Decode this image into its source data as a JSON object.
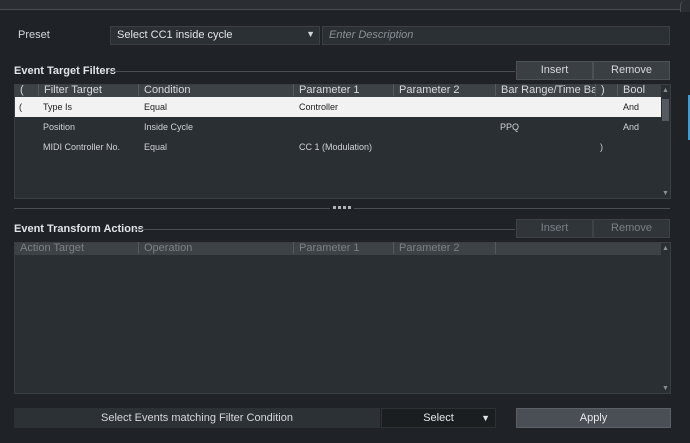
{
  "preset": {
    "label": "Preset",
    "value": "Select CC1 inside cycle",
    "description_placeholder": "Enter Description"
  },
  "filters": {
    "title": "Event Target Filters",
    "insert_label": "Insert",
    "remove_label": "Remove",
    "columns": [
      "(",
      "Filter Target",
      "Condition",
      "Parameter 1",
      "Parameter 2",
      "Bar Range/Time Base",
      ")",
      "Bool"
    ],
    "rows": [
      {
        "open": "(",
        "target": "Type Is",
        "condition": "Equal",
        "param1": "Controller",
        "param2": "",
        "range": "",
        "close": "",
        "bool": "And"
      },
      {
        "open": "",
        "target": "Position",
        "condition": "Inside Cycle",
        "param1": "",
        "param2": "",
        "range": "PPQ",
        "close": "",
        "bool": "And"
      },
      {
        "open": "",
        "target": "MIDI Controller No.",
        "condition": "Equal",
        "param1": "CC 1  (Modulation)",
        "param2": "",
        "range": "",
        "close": ")",
        "bool": ""
      }
    ]
  },
  "actions": {
    "title": "Event Transform Actions",
    "insert_label": "Insert",
    "remove_label": "Remove",
    "columns": [
      "Action Target",
      "Operation",
      "Parameter 1",
      "Parameter 2"
    ]
  },
  "footer": {
    "match_label": "Select Events matching Filter Condition",
    "function_value": "Select",
    "apply_label": "Apply"
  },
  "colors": {
    "background": "#1f2327",
    "selected_row": "#f2f2f2",
    "accent": "#3aa0d8"
  }
}
